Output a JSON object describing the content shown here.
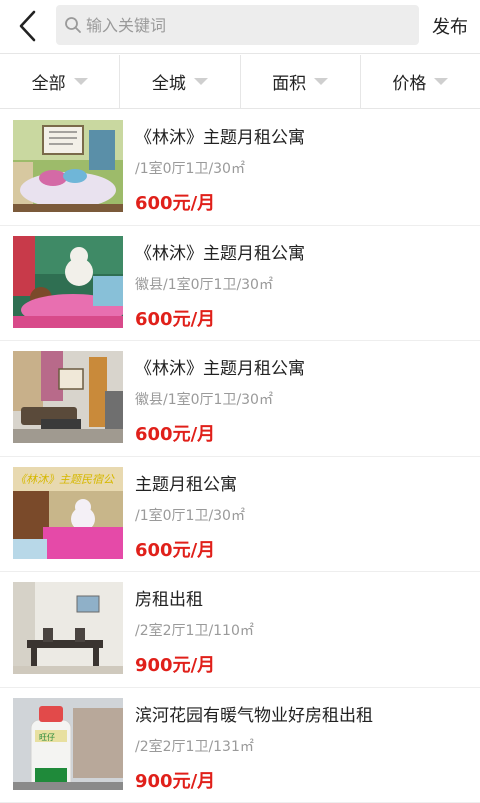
{
  "header": {
    "search_placeholder": "输入关键词",
    "publish_label": "发布"
  },
  "filters": [
    "全部",
    "全城",
    "面积",
    "价格"
  ],
  "listings": [
    {
      "title": "《林沐》主题月租公寓",
      "meta": "/1室0厅1卫/30㎡",
      "price": "600元/月"
    },
    {
      "title": "《林沐》主题月租公寓",
      "meta": "徽县/1室0厅1卫/30㎡",
      "price": "600元/月"
    },
    {
      "title": "《林沐》主题月租公寓",
      "meta": "徽县/1室0厅1卫/30㎡",
      "price": "600元/月"
    },
    {
      "title": "主题月租公寓",
      "meta": "/1室0厅1卫/30㎡",
      "price": "600元/月",
      "thumb_caption": "《林沐》主题民宿公"
    },
    {
      "title": "房租出租",
      "meta": "/2室2厅1卫/110㎡",
      "price": "900元/月"
    },
    {
      "title": "滨河花园有暖气物业好房租出租",
      "meta": "/2室2厅1卫/131㎡",
      "price": "900元/月",
      "thumb_caption": "旺仔"
    }
  ],
  "colors": {
    "price": "#e0201a",
    "meta": "#9a9a9a",
    "divider": "#e6e6e6",
    "search_bg": "#ededed"
  }
}
